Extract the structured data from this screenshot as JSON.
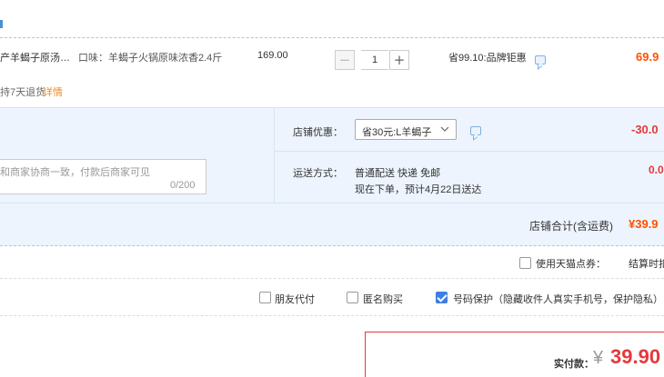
{
  "item": {
    "title": "产羊蝎子原汤…",
    "sku": "口味：羊蝎子火锅原味浓香2.4斤",
    "unit_price": "169.00",
    "quantity": "1",
    "minus": "−",
    "plus": "+",
    "saving": "省99.10:品牌钜惠",
    "subtotal": "69.9",
    "return_policy": "持7天退货",
    "detail_link": "详情"
  },
  "shop": {
    "message_placeholder": "和商家协商一致，付款后商家可见",
    "message_count": "0/200",
    "discount_label": "店铺优惠：",
    "discount_selected": "省30元:L羊蝎子",
    "discount_amount": "-30.0",
    "shipping_label": "运送方式：",
    "shipping_method": "普通配送 快递 免邮",
    "shipping_eta": "现在下单，预计4月22日送达",
    "shipping_amount": "0.0",
    "total_label": "店铺合计(含运费)",
    "total_value": "¥39.9"
  },
  "options": {
    "tmall_coupon": "使用天猫点券：",
    "settle_time": "结算时扣",
    "friend_pay": "朋友代付",
    "anonymous": "匿名购买",
    "number_protect": "号码保护（隐藏收件人真实手机号，保护隐私）"
  },
  "payment": {
    "label": "实付款：",
    "currency": "¥",
    "amount": "39.90"
  },
  "colors": {
    "accent_blue": "#3d7fe3",
    "price_red": "#e4393c",
    "orange": "#ff5000",
    "panel_bg": "#edf4fd"
  }
}
